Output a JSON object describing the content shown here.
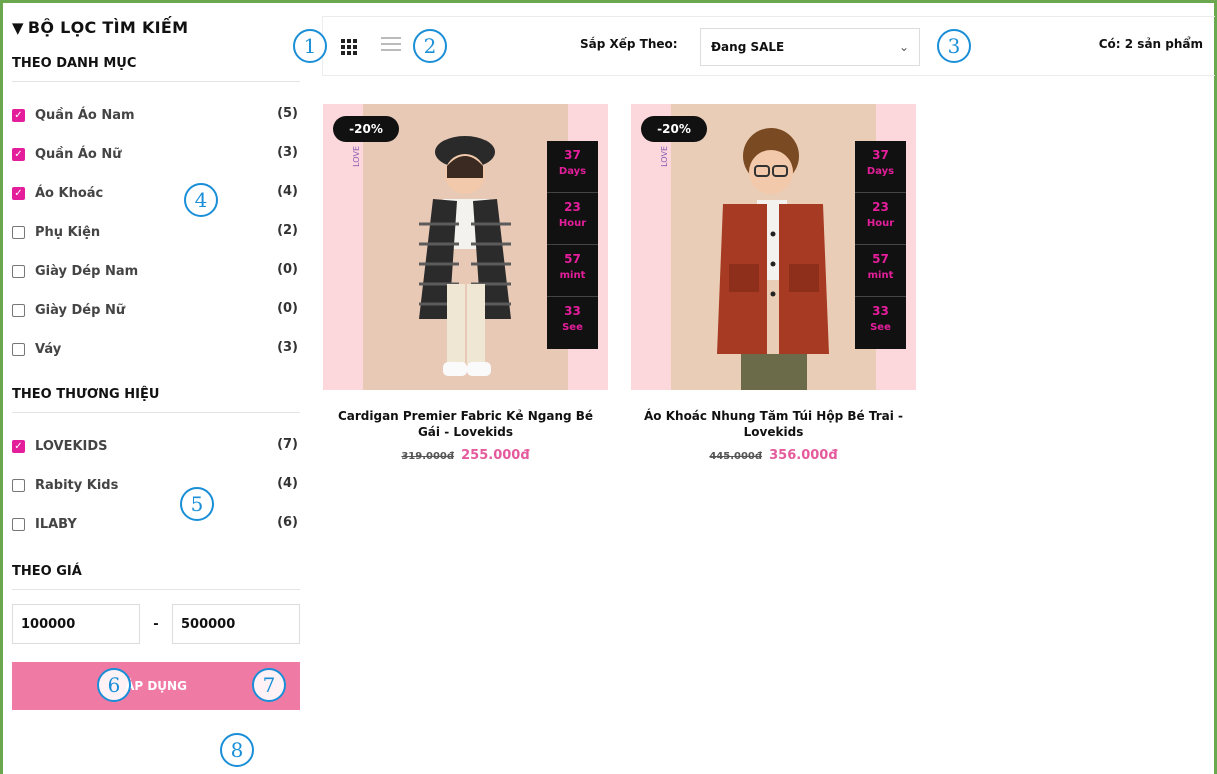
{
  "sidebar": {
    "title": "BỘ LỌC TÌM KIẾM",
    "sections": {
      "category": {
        "title": "THEO DANH MỤC",
        "items": [
          {
            "label": "Quần Áo Nam",
            "count": "(5)",
            "checked": true
          },
          {
            "label": "Quần Áo Nữ",
            "count": "(3)",
            "checked": true
          },
          {
            "label": "Áo Khoác",
            "count": "(4)",
            "checked": true
          },
          {
            "label": "Phụ Kiện",
            "count": "(2)",
            "checked": false
          },
          {
            "label": "Giày Dép Nam",
            "count": "(0)",
            "checked": false
          },
          {
            "label": "Giày Dép Nữ",
            "count": "(0)",
            "checked": false
          },
          {
            "label": "Váy",
            "count": "(3)",
            "checked": false
          }
        ]
      },
      "brand": {
        "title": "THEO THƯƠNG HIỆU",
        "items": [
          {
            "label": "LOVEKIDS",
            "count": "(7)",
            "checked": true
          },
          {
            "label": "Rabity Kids",
            "count": "(4)",
            "checked": false
          },
          {
            "label": "ILABY",
            "count": "(6)",
            "checked": false
          }
        ]
      },
      "price": {
        "title": "THEO GIÁ",
        "min": "100000",
        "max": "500000",
        "separator": "-"
      }
    },
    "apply_label": "ÁP DỤNG"
  },
  "toolbar": {
    "sort_label": "Sắp Xếp Theo:",
    "sort_value": "Đang SALE",
    "result_count": "Có: 2 sản phẩm"
  },
  "products": [
    {
      "name": "Cardigan Premier Fabric Kẻ Ngang Bé Gái - Lovekids",
      "old_price": "319.000đ",
      "new_price": "255.000đ",
      "discount": "-20%",
      "brandmark": "LOVE",
      "countdown": [
        {
          "n": "37",
          "u": "Days"
        },
        {
          "n": "23",
          "u": "Hour"
        },
        {
          "n": "57",
          "u": "mint"
        },
        {
          "n": "33",
          "u": "See"
        }
      ]
    },
    {
      "name": "Áo Khoác Nhung Tăm Túi Hộp Bé Trai - Lovekids",
      "old_price": "445.000đ",
      "new_price": "356.000đ",
      "discount": "-20%",
      "brandmark": "LOVE",
      "countdown": [
        {
          "n": "37",
          "u": "Days"
        },
        {
          "n": "23",
          "u": "Hour"
        },
        {
          "n": "57",
          "u": "mint"
        },
        {
          "n": "33",
          "u": "See"
        }
      ]
    }
  ],
  "markers": [
    "1",
    "2",
    "3",
    "4",
    "5",
    "6",
    "7",
    "8"
  ],
  "colors": {
    "accent": "#e41e9b",
    "apply_bg": "#ef7aa4",
    "price": "#e45a9c",
    "marker": "#1a8fd8",
    "frame": "#6aa84f"
  },
  "icons": [
    "filter-icon",
    "grid-view-icon",
    "list-view-icon",
    "chevron-down-icon",
    "check-icon"
  ]
}
